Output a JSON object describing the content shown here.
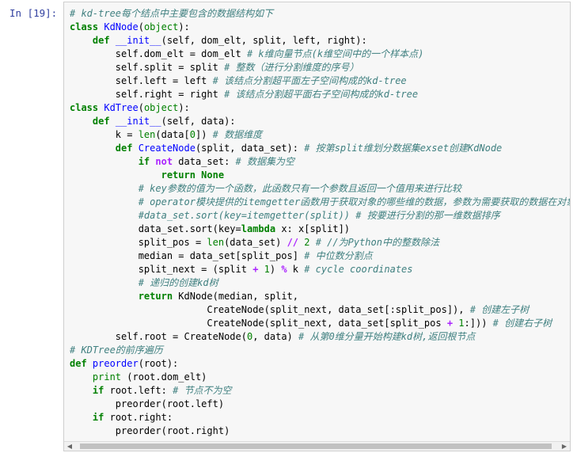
{
  "prompt": "In [19]:",
  "lines": [
    [
      [
        "cm",
        "# kd-tree每个结点中主要包含的数据结构如下"
      ]
    ],
    [
      [
        "kw",
        "class "
      ],
      [
        "cn",
        "KdNode"
      ],
      [
        "",
        "("
      ],
      [
        "bi",
        "object"
      ],
      [
        "",
        "):"
      ]
    ],
    [
      [
        "",
        "    "
      ],
      [
        "kw",
        "def "
      ],
      [
        "fn",
        "__init__"
      ],
      [
        "",
        "(self, dom_elt, split, left, right):"
      ]
    ],
    [
      [
        "",
        "        self.dom_elt "
      ],
      [
        "",
        "= "
      ],
      [
        "",
        "dom_elt "
      ],
      [
        "cm",
        "# k维向量节点(k维空间中的一个样本点)"
      ]
    ],
    [
      [
        "",
        "        self.split = split "
      ],
      [
        "cm",
        "# 整数（进行分割维度的序号）"
      ]
    ],
    [
      [
        "",
        "        self.left = left "
      ],
      [
        "cm",
        "# 该结点分割超平面左子空间构成的kd-tree"
      ]
    ],
    [
      [
        "",
        "        self.right = right "
      ],
      [
        "cm",
        "# 该结点分割超平面右子空间构成的kd-tree"
      ]
    ],
    [
      [
        "kw",
        "class "
      ],
      [
        "cn",
        "KdTree"
      ],
      [
        "",
        "("
      ],
      [
        "bi",
        "object"
      ],
      [
        "",
        "):"
      ]
    ],
    [
      [
        "",
        "    "
      ],
      [
        "kw",
        "def "
      ],
      [
        "fn",
        "__init__"
      ],
      [
        "",
        "(self, data):"
      ]
    ],
    [
      [
        "",
        "        k = "
      ],
      [
        "bi",
        "len"
      ],
      [
        "",
        "(data["
      ],
      [
        "nu",
        "0"
      ],
      [
        "",
        "]) "
      ],
      [
        "cm",
        "# 数据维度"
      ]
    ],
    [
      [
        "",
        "        "
      ],
      [
        "kw",
        "def "
      ],
      [
        "fn",
        "CreateNode"
      ],
      [
        "",
        "(split, data_set): "
      ],
      [
        "cm",
        "# 按第split维划分数据集exset创建KdNode"
      ]
    ],
    [
      [
        "",
        "            "
      ],
      [
        "kw",
        "if "
      ],
      [
        "op",
        "not "
      ],
      [
        "",
        "data_set: "
      ],
      [
        "cm",
        "# 数据集为空"
      ]
    ],
    [
      [
        "",
        "                "
      ],
      [
        "kw",
        "return "
      ],
      [
        "kw",
        "None"
      ]
    ],
    [
      [
        "",
        "            "
      ],
      [
        "cm",
        "# key参数的值为一个函数，此函数只有一个参数且返回一个值用来进行比较"
      ]
    ],
    [
      [
        "",
        "            "
      ],
      [
        "cm",
        "# operator模块提供的itemgetter函数用于获取对象的哪些维的数据，参数为需要获取的数据在对象中的序号"
      ]
    ],
    [
      [
        "",
        "            "
      ],
      [
        "cm",
        "#data_set.sort(key=itemgetter(split)) # 按要进行分割的那一维数据排序"
      ]
    ],
    [
      [
        "",
        "            data_set.sort(key="
      ],
      [
        "kw",
        "lambda "
      ],
      [
        "",
        "x: x[split])"
      ]
    ],
    [
      [
        "",
        "            split_pos = "
      ],
      [
        "bi",
        "len"
      ],
      [
        "",
        "(data_set) "
      ],
      [
        "op",
        "//"
      ],
      [
        "",
        ""
      ],
      [
        "",
        ""
      ],
      [
        "",
        ""
      ],
      [
        "",
        ""
      ],
      [
        "",
        ""
      ],
      [
        "",
        ""
      ],
      [
        "",
        ""
      ],
      [
        "",
        ""
      ],
      [
        "",
        ""
      ],
      [
        "",
        ""
      ],
      [
        "",
        ""
      ],
      [
        "",
        ""
      ],
      [
        "",
        ""
      ],
      [
        "",
        ""
      ],
      [
        "",
        ""
      ],
      [
        "",
        ""
      ],
      [
        "",
        ""
      ],
      [
        "",
        ""
      ],
      [
        "",
        ""
      ],
      [
        "",
        ""
      ],
      [
        "",
        ""
      ],
      [
        "",
        ""
      ],
      [
        "",
        ""
      ],
      [
        "",
        ""
      ],
      [
        "",
        ""
      ],
      [
        "",
        ""
      ],
      [
        "",
        ""
      ],
      [
        "",
        ""
      ],
      [
        "",
        ""
      ],
      [
        "",
        ""
      ],
      [
        "",
        ""
      ],
      [
        "",
        ""
      ],
      [
        "",
        ""
      ],
      [
        "",
        ""
      ],
      [
        "",
        ""
      ],
      [
        "",
        ""
      ],
      [
        "",
        ""
      ],
      [
        "",
        ""
      ],
      [
        "",
        ""
      ],
      [
        "",
        ""
      ],
      [
        "",
        ""
      ],
      [
        "",
        ""
      ],
      [
        "",
        ""
      ],
      [
        "",
        ""
      ],
      [
        "",
        ""
      ],
      [
        "",
        ""
      ],
      [
        "",
        ""
      ],
      [
        "",
        ""
      ],
      [
        "",
        ""
      ],
      [
        "",
        ""
      ],
      [
        "",
        ""
      ],
      [
        "",
        ""
      ],
      [
        "",
        ""
      ],
      [
        "",
        ""
      ],
      [
        "",
        ""
      ],
      [
        "",
        ""
      ],
      [
        "",
        ""
      ],
      [
        "",
        ""
      ],
      [
        "",
        ""
      ],
      [
        "",
        ""
      ],
      [
        "",
        ""
      ],
      [
        "",
        ""
      ],
      [
        "",
        ""
      ],
      [
        "",
        ""
      ],
      [
        "",
        ""
      ],
      [
        "",
        ""
      ],
      [
        "",
        ""
      ],
      [
        "",
        ""
      ],
      [
        "",
        ""
      ],
      [
        "",
        ""
      ],
      [
        "",
        ""
      ],
      [
        "",
        ""
      ],
      [
        "",
        ""
      ],
      [
        "",
        ""
      ],
      [
        "",
        ""
      ],
      [
        "",
        ""
      ],
      [
        "",
        ""
      ],
      [
        "",
        ""
      ],
      [
        "",
        ""
      ],
      [
        "",
        ""
      ],
      [
        "",
        ""
      ],
      [
        "",
        ""
      ],
      [
        "",
        ""
      ],
      [
        "",
        ""
      ],
      [
        "",
        ""
      ],
      [
        "",
        ""
      ],
      [
        "",
        ""
      ],
      [
        "",
        ""
      ],
      [
        "",
        ""
      ],
      [
        "",
        ""
      ],
      [
        "",
        ""
      ],
      [
        "",
        ""
      ],
      [
        "",
        ""
      ],
      [
        "",
        ""
      ],
      [
        "",
        ""
      ],
      [
        "",
        ""
      ],
      [
        "",
        ""
      ],
      [
        "",
        ""
      ],
      [
        "",
        ""
      ],
      [
        "",
        ""
      ],
      [
        "",
        ""
      ],
      [
        "",
        ""
      ],
      [
        "",
        ""
      ],
      [
        "",
        ""
      ],
      [
        "",
        ""
      ],
      [
        "",
        ""
      ],
      [
        "",
        ""
      ],
      [
        "",
        ""
      ],
      [
        "",
        ""
      ],
      [
        "",
        ""
      ],
      [
        "",
        ""
      ],
      [
        "",
        ""
      ],
      [
        "",
        ""
      ],
      [
        "",
        ""
      ],
      [
        "",
        ""
      ],
      [
        "",
        ""
      ],
      [
        "",
        ""
      ],
      [
        "",
        ""
      ],
      [
        "",
        ""
      ],
      [
        "",
        ""
      ],
      [
        "",
        ""
      ],
      [
        "",
        ""
      ],
      [
        "",
        ""
      ],
      [
        "",
        ""
      ],
      [
        "",
        ""
      ],
      [
        "",
        ""
      ],
      [
        "",
        ""
      ],
      [
        "",
        ""
      ],
      [
        "",
        ""
      ],
      [
        "",
        ""
      ],
      [
        "",
        ""
      ],
      [
        "",
        ""
      ],
      [
        "",
        ""
      ],
      [
        "",
        ""
      ],
      [
        "",
        ""
      ],
      [
        "",
        ""
      ],
      [
        "",
        ""
      ],
      [
        "",
        ""
      ],
      [
        "",
        ""
      ],
      [
        "",
        ""
      ],
      [
        "",
        ""
      ],
      [
        "",
        ""
      ],
      [
        "",
        ""
      ],
      [
        "",
        ""
      ],
      [
        "",
        ""
      ],
      [
        "",
        ""
      ],
      [
        "",
        ""
      ],
      [
        "",
        ""
      ],
      [
        "",
        ""
      ],
      [
        "",
        ""
      ],
      [
        "",
        ""
      ],
      [
        "",
        ""
      ],
      [
        "",
        ""
      ],
      [
        "",
        ""
      ],
      [
        "",
        ""
      ],
      [
        "",
        ""
      ],
      [
        "",
        ""
      ],
      [
        "",
        ""
      ],
      [
        "",
        ""
      ],
      [
        "",
        ""
      ],
      [
        "",
        ""
      ],
      [
        "",
        ""
      ],
      [
        "",
        ""
      ],
      [
        "",
        ""
      ],
      [
        "",
        " "
      ],
      [
        "nu",
        "2 "
      ],
      [
        "cm",
        "# //为Python中的整数除法"
      ]
    ],
    [
      [
        "",
        "            median = data_set[split_pos] "
      ],
      [
        "cm",
        "# 中位数分割点"
      ]
    ],
    [
      [
        "",
        "            split_next = (split "
      ],
      [
        "op",
        "+ "
      ],
      [
        "nu",
        "1"
      ],
      [
        "",
        ") "
      ],
      [
        "op",
        "% "
      ],
      [
        "",
        "k "
      ],
      [
        "cm",
        "# cycle coordinates"
      ]
    ],
    [
      [
        "",
        "            "
      ],
      [
        "cm",
        "# 递归的创建kd树"
      ]
    ],
    [
      [
        "",
        "            "
      ],
      [
        "kw",
        "return "
      ],
      [
        "",
        "KdNode(median, split,"
      ]
    ],
    [
      [
        "",
        "                        CreateNode(split_next, data_set[:split_pos]), "
      ],
      [
        "cm",
        "# 创建左子树"
      ]
    ],
    [
      [
        "",
        "                        CreateNode(split_next, data_set[split_pos "
      ],
      [
        "op",
        "+ "
      ],
      [
        "nu",
        "1"
      ],
      [
        "",
        ":])) "
      ],
      [
        "cm",
        "# 创建右子树"
      ]
    ],
    [
      [
        "",
        "        self.root = CreateNode("
      ],
      [
        "nu",
        "0"
      ],
      [
        "",
        ", data) "
      ],
      [
        "cm",
        "# 从第0维分量开始构建kd树,返回根节点"
      ]
    ],
    [
      [
        "cm",
        "# KDTree的前序遍历"
      ]
    ],
    [
      [
        "kw",
        "def "
      ],
      [
        "fn",
        "preorder"
      ],
      [
        "",
        "(root):"
      ]
    ],
    [
      [
        "",
        "    "
      ],
      [
        "kp",
        "print "
      ],
      [
        "",
        "(root.dom_elt)"
      ]
    ],
    [
      [
        "",
        "    "
      ],
      [
        "kw",
        "if "
      ],
      [
        "",
        "root.left: "
      ],
      [
        "cm",
        "# 节点不为空"
      ]
    ],
    [
      [
        "",
        "        preorder(root.left)"
      ]
    ],
    [
      [
        "",
        "    "
      ],
      [
        "kw",
        "if "
      ],
      [
        "",
        "root.right:"
      ]
    ],
    [
      [
        "",
        "        preorder(root.right)"
      ]
    ]
  ]
}
